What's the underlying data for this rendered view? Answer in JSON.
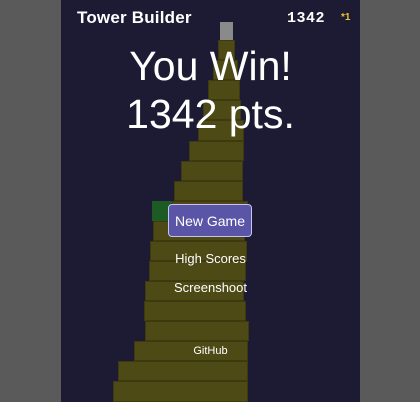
{
  "hud": {
    "title": "Tower Builder",
    "score": "1342",
    "multiplier": "*1"
  },
  "overlay": {
    "headline": "You Win!",
    "points": "1342 pts."
  },
  "menu": {
    "new_game": "New Game",
    "high_scores": "High Scores",
    "screenshot": "Screenshoot",
    "github": "GitHub"
  },
  "colors": {
    "background": "#1c1b33",
    "block": "#4e4a16",
    "button": "#5a55a6",
    "multiplier": "#e8c23a"
  }
}
